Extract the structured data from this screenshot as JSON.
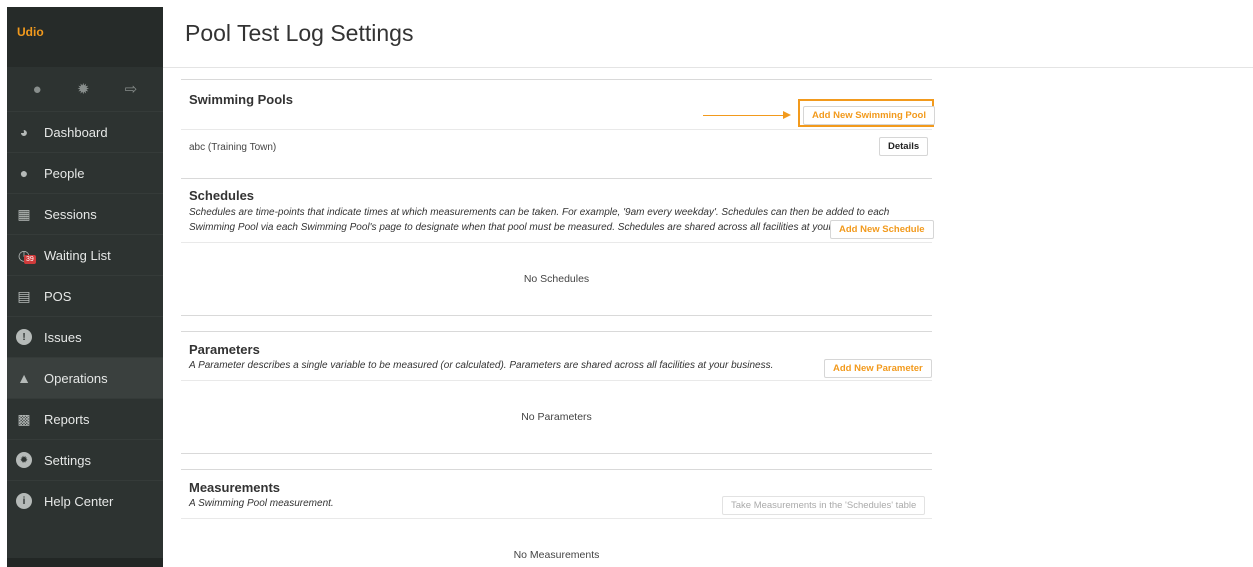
{
  "sidebar": {
    "brand": "Udio",
    "icons": [
      "chat-icon",
      "gear-icon",
      "logout-icon"
    ],
    "items": [
      {
        "label": "Dashboard",
        "icon": "dashboard-icon"
      },
      {
        "label": "People",
        "icon": "person-icon"
      },
      {
        "label": "Sessions",
        "icon": "clipboard-icon"
      },
      {
        "label": "Waiting List",
        "icon": "clock-icon",
        "badge": "39"
      },
      {
        "label": "POS",
        "icon": "register-icon"
      },
      {
        "label": "Issues",
        "icon": "alert-icon"
      },
      {
        "label": "Operations",
        "icon": "toolbox-icon",
        "active": true
      },
      {
        "label": "Reports",
        "icon": "document-icon"
      },
      {
        "label": "Settings",
        "icon": "settings-icon"
      },
      {
        "label": "Help Center",
        "icon": "info-icon"
      }
    ]
  },
  "page": {
    "title": "Pool Test Log Settings"
  },
  "pools": {
    "title": "Swimming Pools",
    "add_button": "Add New Swimming Pool",
    "rows": [
      {
        "name": "abc (Training Town)",
        "action": "Details"
      }
    ]
  },
  "schedules": {
    "title": "Schedules",
    "description": "Schedules are time-points that indicate times at which measurements can be taken. For example, '9am every weekday'. Schedules can then be added to each Swimming Pool via each Swimming Pool's page to designate when that pool must be measured. Schedules are shared across all facilities at your business.",
    "add_button": "Add New Schedule",
    "empty": "No Schedules"
  },
  "parameters": {
    "title": "Parameters",
    "description": "A Parameter describes a single variable to be measured (or calculated). Parameters are shared across all facilities at your business.",
    "add_button": "Add New Parameter",
    "empty": "No Parameters"
  },
  "measurements": {
    "title": "Measurements",
    "description": "A Swimming Pool measurement.",
    "action_button": "Take Measurements in the 'Schedules' table",
    "empty": "No Measurements"
  },
  "colors": {
    "accent": "#f29a1d",
    "sidebar": "#2d3331",
    "badge": "#cf3b3b"
  }
}
